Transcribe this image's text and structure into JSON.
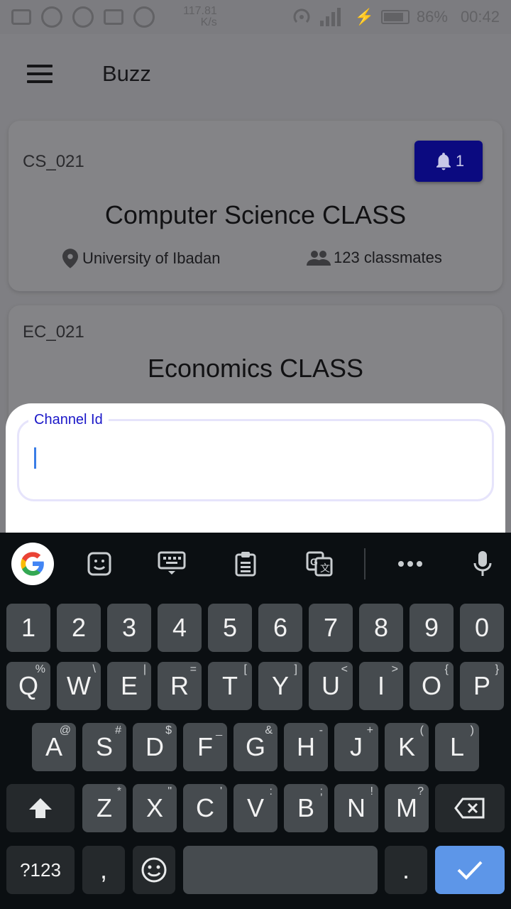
{
  "status_bar": {
    "speed_value": "117.81",
    "speed_unit": "K/s",
    "battery": "86%",
    "time": "00:42"
  },
  "app_bar": {
    "title": "Buzz"
  },
  "classes": [
    {
      "code": "CS_021",
      "name": "Computer Science CLASS",
      "notification_count": "1",
      "location": "University of Ibadan",
      "classmates": "123 classmates"
    },
    {
      "code": "EC_021",
      "name": "Economics CLASS"
    }
  ],
  "sheet": {
    "field_label": "Channel Id",
    "field_value": ""
  },
  "keyboard": {
    "number_row": [
      "1",
      "2",
      "3",
      "4",
      "5",
      "6",
      "7",
      "8",
      "9",
      "0"
    ],
    "row1": [
      {
        "k": "Q",
        "h": "%"
      },
      {
        "k": "W",
        "h": "\\"
      },
      {
        "k": "E",
        "h": "|"
      },
      {
        "k": "R",
        "h": "="
      },
      {
        "k": "T",
        "h": "["
      },
      {
        "k": "Y",
        "h": "]"
      },
      {
        "k": "U",
        "h": "<"
      },
      {
        "k": "I",
        "h": ">"
      },
      {
        "k": "O",
        "h": "{"
      },
      {
        "k": "P",
        "h": "}"
      }
    ],
    "row2": [
      {
        "k": "A",
        "h": "@"
      },
      {
        "k": "S",
        "h": "#"
      },
      {
        "k": "D",
        "h": "$"
      },
      {
        "k": "F",
        "h": "_"
      },
      {
        "k": "G",
        "h": "&"
      },
      {
        "k": "H",
        "h": "-"
      },
      {
        "k": "J",
        "h": "+"
      },
      {
        "k": "K",
        "h": "("
      },
      {
        "k": "L",
        "h": ")"
      }
    ],
    "row3": [
      {
        "k": "Z",
        "h": "*"
      },
      {
        "k": "X",
        "h": "\""
      },
      {
        "k": "C",
        "h": "'"
      },
      {
        "k": "V",
        "h": ":"
      },
      {
        "k": "B",
        "h": ";"
      },
      {
        "k": "N",
        "h": "!"
      },
      {
        "k": "M",
        "h": "?"
      }
    ],
    "symbols_label": "?123",
    "comma": ",",
    "period": "."
  }
}
